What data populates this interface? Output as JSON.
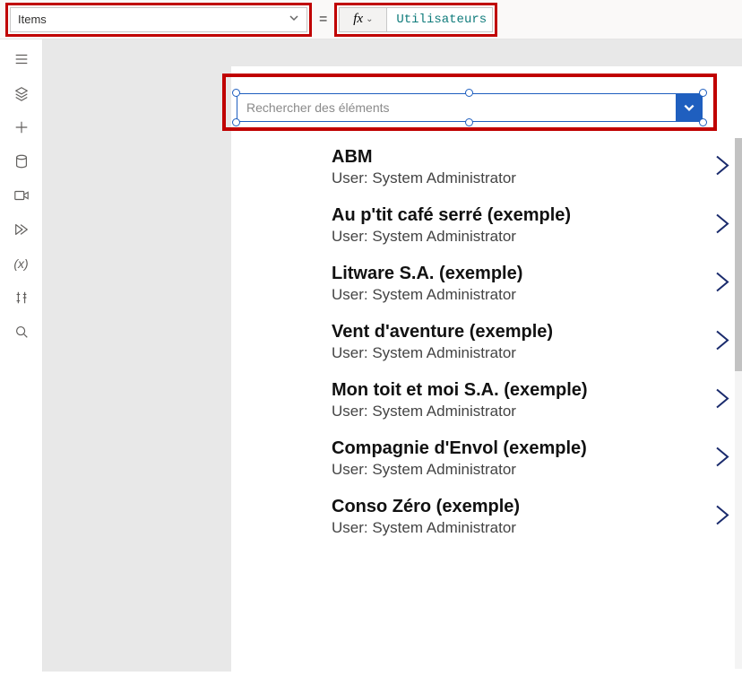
{
  "property_selector": {
    "selected": "Items"
  },
  "formula": {
    "fx_label": "fx",
    "value": "Utilisateurs"
  },
  "combobox": {
    "placeholder": "Rechercher des éléments"
  },
  "gallery": {
    "subtitle_prefix": "User: ",
    "items": [
      {
        "title": "ABM",
        "subtitle": "User: System Administrator"
      },
      {
        "title": "Au p'tit café serré (exemple)",
        "subtitle": "User: System Administrator"
      },
      {
        "title": "Litware S.A. (exemple)",
        "subtitle": "User: System Administrator"
      },
      {
        "title": "Vent d'aventure (exemple)",
        "subtitle": "User: System Administrator"
      },
      {
        "title": "Mon toit et moi S.A. (exemple)",
        "subtitle": "User: System Administrator"
      },
      {
        "title": "Compagnie d'Envol (exemple)",
        "subtitle": "User: System Administrator"
      },
      {
        "title": "Conso Zéro (exemple)",
        "subtitle": "User: System Administrator"
      }
    ]
  },
  "side_rail_icons": [
    "hamburger-icon",
    "layers-icon",
    "plus-icon",
    "database-icon",
    "media-icon",
    "power-automate-icon",
    "variable-icon",
    "tools-icon",
    "search-icon"
  ],
  "highlight_color": "#c00000",
  "accent_color": "#1f5fbf"
}
